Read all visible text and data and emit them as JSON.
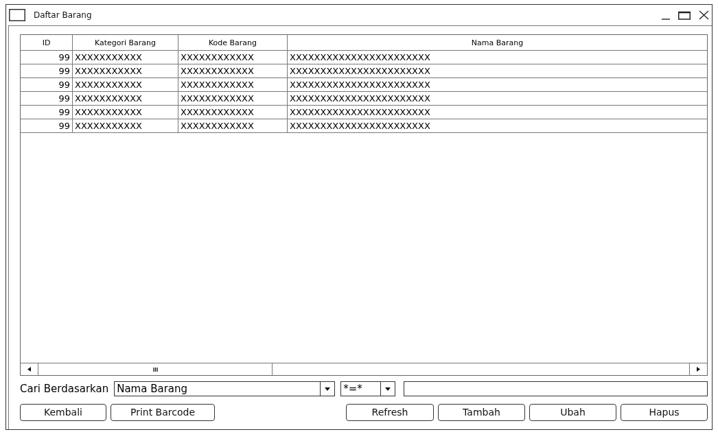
{
  "window": {
    "title": "Daftar Barang"
  },
  "table": {
    "columns": [
      "ID",
      "Kategori Barang",
      "Kode Barang",
      "Nama Barang"
    ],
    "rows": [
      [
        "99",
        "XXXXXXXXXXX",
        "XXXXXXXXXXXX",
        "XXXXXXXXXXXXXXXXXXXXXXX"
      ],
      [
        "99",
        "XXXXXXXXXXX",
        "XXXXXXXXXXXX",
        "XXXXXXXXXXXXXXXXXXXXXXX"
      ],
      [
        "99",
        "XXXXXXXXXXX",
        "XXXXXXXXXXXX",
        "XXXXXXXXXXXXXXXXXXXXXXX"
      ],
      [
        "99",
        "XXXXXXXXXXX",
        "XXXXXXXXXXXX",
        "XXXXXXXXXXXXXXXXXXXXXXX"
      ],
      [
        "99",
        "XXXXXXXXXXX",
        "XXXXXXXXXXXX",
        "XXXXXXXXXXXXXXXXXXXXXXX"
      ],
      [
        "99",
        "XXXXXXXXXXX",
        "XXXXXXXXXXXX",
        "XXXXXXXXXXXXXXXXXXXXXXX"
      ]
    ]
  },
  "search": {
    "label": "Cari Berdasarkan",
    "field": "Nama Barang",
    "operator": "*=*"
  },
  "buttons_left": [
    "Kembali",
    "Print Barcode"
  ],
  "buttons_right": [
    "Refresh",
    "Tambah",
    "Ubah",
    "Hapus"
  ]
}
